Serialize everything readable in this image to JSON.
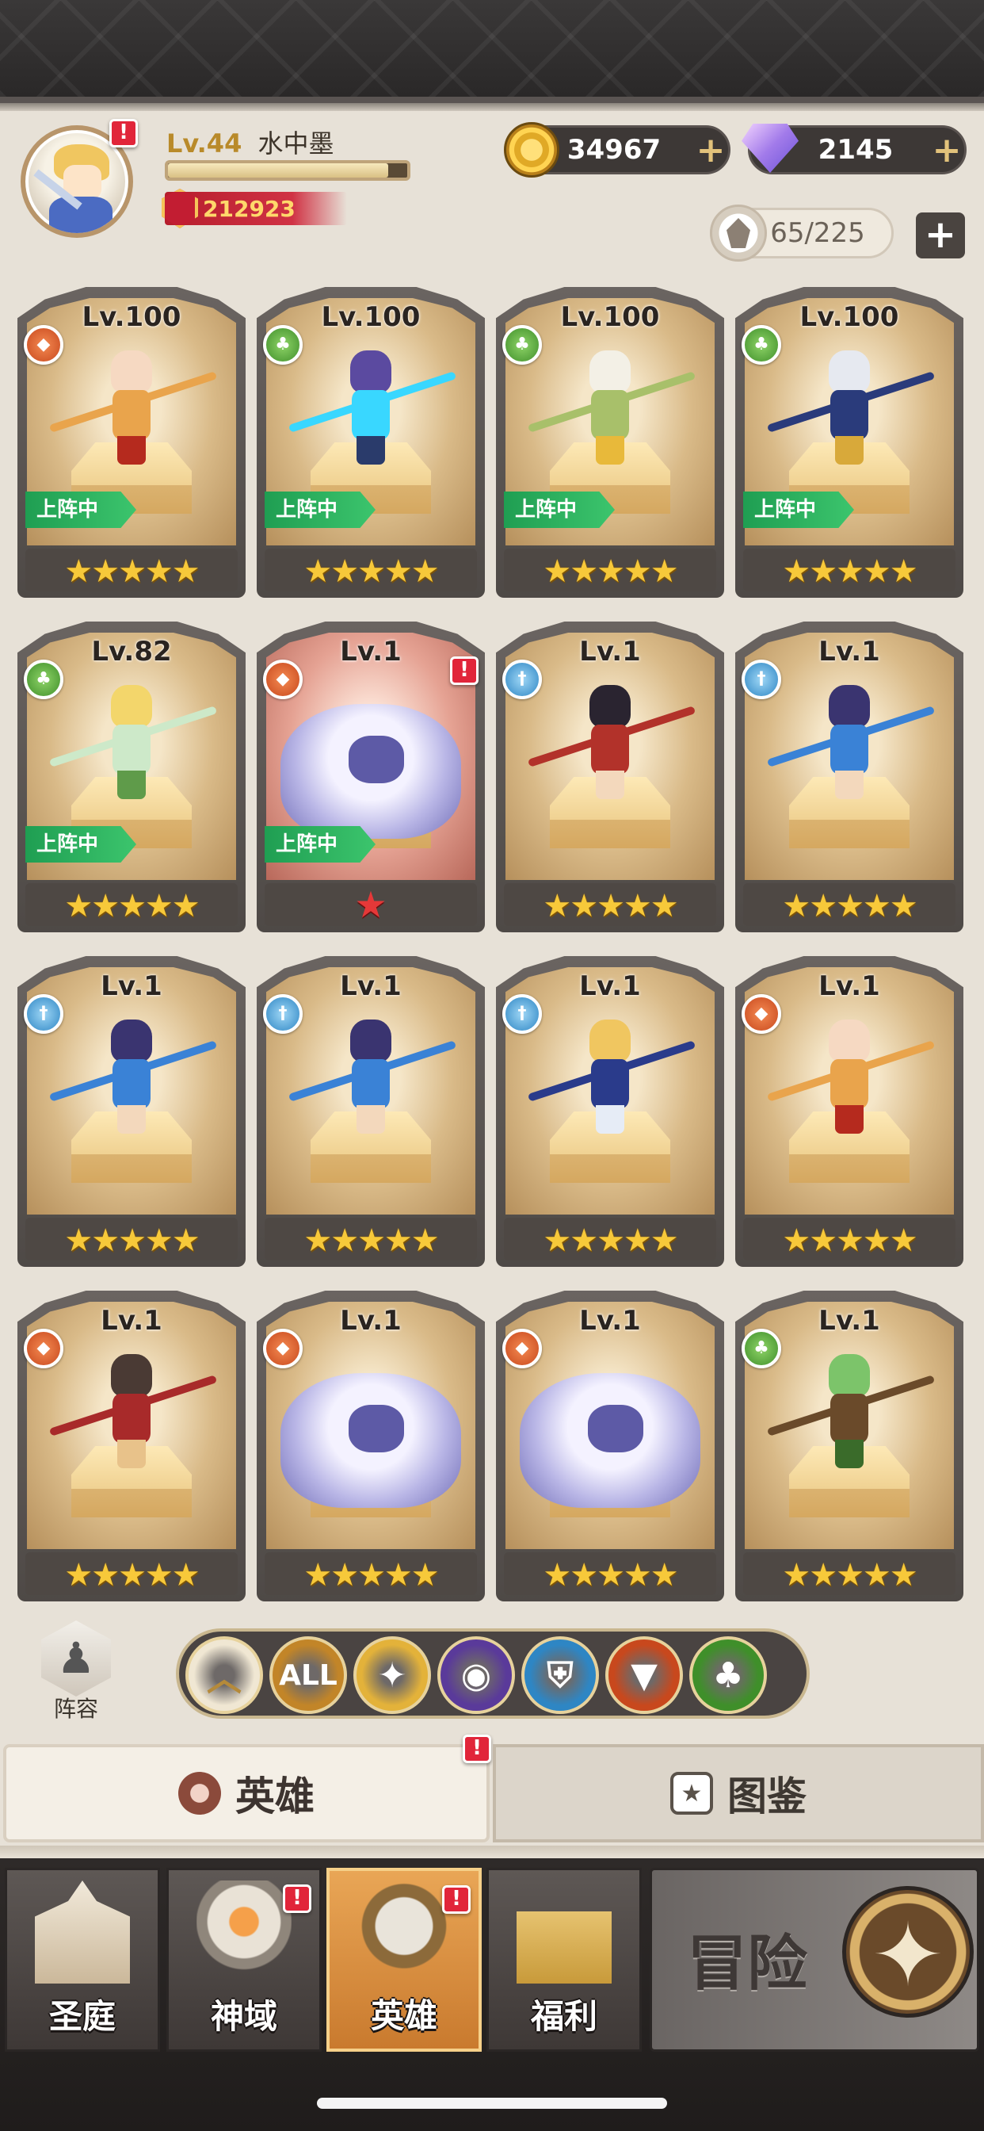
{
  "player": {
    "level": "Lv.44",
    "name": "水中墨",
    "power": "212923",
    "xp_fraction": 0.92
  },
  "currency": {
    "gold": "34967",
    "gems": "2145",
    "plus_glyph": "+"
  },
  "roster": {
    "count": "65/225",
    "add_glyph": "+"
  },
  "badges": {
    "alert_glyph": "!"
  },
  "heroes": [
    {
      "level": "Lv.100",
      "element": "fire",
      "deployed": "上阵中",
      "stars": "★★★★★",
      "sprite": "flame-archer",
      "colors": [
        "#f6d9c2",
        "#e9a44c",
        "#b52a1e"
      ]
    },
    {
      "level": "Lv.100",
      "element": "nature",
      "deployed": "上阵中",
      "stars": "★★★★★",
      "sprite": "lightning-mage",
      "colors": [
        "#5b4aa0",
        "#39d7ff",
        "#2a3b6b"
      ]
    },
    {
      "level": "Lv.100",
      "element": "nature",
      "deployed": "上阵中",
      "stars": "★★★★★",
      "sprite": "hammer-warrior",
      "colors": [
        "#f3f0e6",
        "#a8c06a",
        "#e8b93a"
      ]
    },
    {
      "level": "Lv.100",
      "element": "nature",
      "deployed": "上阵中",
      "stars": "★★★★★",
      "sprite": "spear-knight",
      "colors": [
        "#e6e9f0",
        "#2a3b7b",
        "#d8a93a"
      ]
    },
    {
      "level": "Lv.82",
      "element": "nature",
      "deployed": "上阵中",
      "stars": "★★★★★",
      "sprite": "flower-fairy",
      "colors": [
        "#f3d66b",
        "#cde9c9",
        "#5f9b4a"
      ]
    },
    {
      "level": "Lv.1",
      "element": "fire",
      "deployed": "上阵中",
      "stars": "★",
      "sprite": "yeti-rider",
      "colors": [
        "#f4f2ff",
        "#6f6cb6"
      ],
      "single_star": true,
      "alert": true,
      "monster": true
    },
    {
      "level": "Lv.1",
      "element": "light",
      "deployed": "",
      "stars": "★★★★★",
      "sprite": "gunslinger",
      "colors": [
        "#2a2430",
        "#b2322a",
        "#f3d8bc"
      ]
    },
    {
      "level": "Lv.1",
      "element": "light",
      "deployed": "",
      "stars": "★★★★★",
      "sprite": "lancer",
      "colors": [
        "#3a3470",
        "#3a82d6",
        "#f3d8bc"
      ]
    },
    {
      "level": "Lv.1",
      "element": "light",
      "deployed": "",
      "stars": "★★★★★",
      "sprite": "lancer",
      "colors": [
        "#3a3470",
        "#3a82d6",
        "#f3d8bc"
      ]
    },
    {
      "level": "Lv.1",
      "element": "light",
      "deployed": "",
      "stars": "★★★★★",
      "sprite": "lancer",
      "colors": [
        "#3a3470",
        "#3a82d6",
        "#f3d8bc"
      ]
    },
    {
      "level": "Lv.1",
      "element": "light",
      "deployed": "",
      "stars": "★★★★★",
      "sprite": "blond-swordsman",
      "colors": [
        "#f0c660",
        "#2a3b8b",
        "#e6ecf6"
      ]
    },
    {
      "level": "Lv.1",
      "element": "fire",
      "deployed": "",
      "stars": "★★★★★",
      "sprite": "flame-archer",
      "colors": [
        "#f6d9c2",
        "#e9a44c",
        "#b52a1e"
      ]
    },
    {
      "level": "Lv.1",
      "element": "fire",
      "deployed": "",
      "stars": "★★★★★",
      "sprite": "cat-rogue",
      "colors": [
        "#4a3a34",
        "#a82a2a",
        "#e8c28a"
      ]
    },
    {
      "level": "Lv.1",
      "element": "fire",
      "deployed": "",
      "stars": "★★★★★",
      "sprite": "yeti-rider",
      "colors": [
        "#f4f2ff",
        "#6f6cb6"
      ],
      "monster": true
    },
    {
      "level": "Lv.1",
      "element": "fire",
      "deployed": "",
      "stars": "★★★★★",
      "sprite": "yeti-rider",
      "colors": [
        "#f4f2ff",
        "#6f6cb6"
      ],
      "monster": true
    },
    {
      "level": "Lv.1",
      "element": "nature",
      "deployed": "",
      "stars": "★★★★★",
      "sprite": "treant-druid",
      "colors": [
        "#7cc46a",
        "#6a4a2a",
        "#3a6b2a"
      ]
    }
  ],
  "lineup": {
    "label": "阵容"
  },
  "filters": [
    {
      "id": "collapse",
      "label": "",
      "icon": "chevron-up-icon",
      "bg": "#f0e7d3"
    },
    {
      "id": "all",
      "label": "ALL",
      "icon": "all-filter-icon",
      "bg": "#c28528"
    },
    {
      "id": "holy",
      "label": "",
      "icon": "holy-star-icon",
      "bg": "#e3b23a"
    },
    {
      "id": "dark",
      "label": "",
      "icon": "dark-eye-icon",
      "bg": "#5a3a9a"
    },
    {
      "id": "light",
      "label": "",
      "icon": "shield-icon",
      "bg": "#2e86c4"
    },
    {
      "id": "fire",
      "label": "",
      "icon": "fox-icon",
      "bg": "#c8481d"
    },
    {
      "id": "nature",
      "label": "",
      "icon": "tree-icon",
      "bg": "#3f8f2a"
    }
  ],
  "tabs": {
    "heroes": "英雄",
    "codex": "图鉴"
  },
  "nav": [
    {
      "label": "圣庭",
      "icon": "castle-icon",
      "alert": false
    },
    {
      "label": "神域",
      "icon": "divine-gate-icon",
      "alert": true
    },
    {
      "label": "英雄",
      "icon": "helmet-icon",
      "alert": true
    },
    {
      "label": "福利",
      "icon": "chest-icon",
      "alert": false
    }
  ],
  "adventure": {
    "label": "冒险"
  },
  "accent": {
    "gold": "#f7c93a",
    "deploy_green": "#1f9e52",
    "alert_red": "#e1253a"
  }
}
